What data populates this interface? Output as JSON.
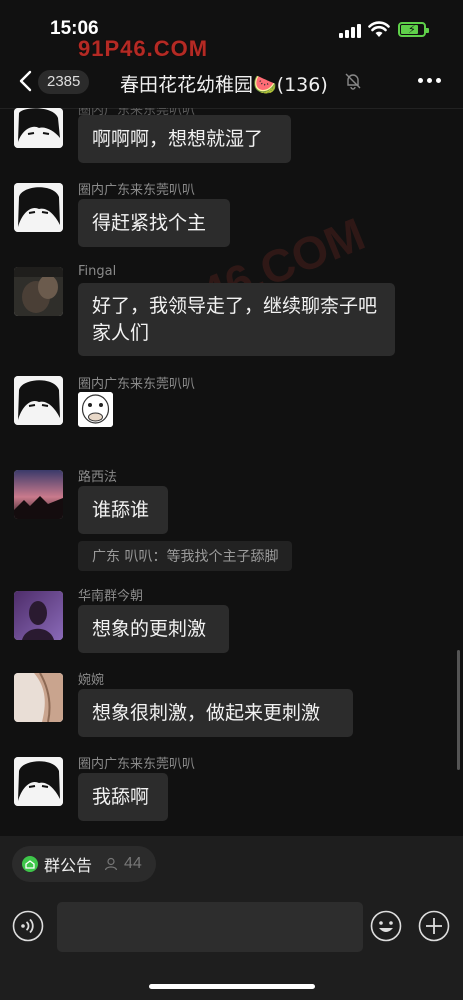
{
  "status_bar": {
    "time": "15:06",
    "watermark": "91P46.COM",
    "battery_level": 0.75,
    "battery_color": "#5fd04a",
    "icons": [
      "signal-icon",
      "wifi-icon",
      "battery-charging-icon"
    ]
  },
  "watermark_overlay": "91P46.COM",
  "nav": {
    "unread_count": "2385",
    "title": "春田花花幼稚园🍉(136)",
    "icons": [
      "back-icon",
      "mute-bell-icon",
      "more-icon"
    ]
  },
  "messages": [
    {
      "sender": "圈内广东来东莞叭叭",
      "text": "啊啊啊，想想就湿了",
      "avatar": "sketch-face"
    },
    {
      "sender": "圈内广东来东莞叭叭",
      "text": "得赶紧找个主",
      "avatar": "sketch-face"
    },
    {
      "sender": "Fingal",
      "text": "好了，我领导走了，继续聊柰子吧家人们",
      "avatar": "dark-photo"
    },
    {
      "sender": "圈内广东来东莞叭叭",
      "sticker": "covering-mouth-sticker",
      "avatar": "sketch-face"
    },
    {
      "sender": "路西法",
      "text": "谁舔谁",
      "quote": "广东 叭叭：等我找个主子舔脚",
      "avatar": "sunset-photo"
    },
    {
      "sender": "华南群今朝",
      "text": "想象的更刺激",
      "avatar": "purple-photo"
    },
    {
      "sender": "婉婉",
      "text": "想象很刺激，做起来更刺激",
      "avatar": "light-photo"
    },
    {
      "sender": "圈内广东来东莞叭叭",
      "text": "我舔啊",
      "avatar": "sketch-face"
    }
  ],
  "bottom_bar": {
    "announcement_label": "群公告",
    "member_count": "44",
    "icons": [
      "voice-icon",
      "emoji-icon",
      "plus-icon"
    ],
    "accent_color": "#3ec64a"
  }
}
